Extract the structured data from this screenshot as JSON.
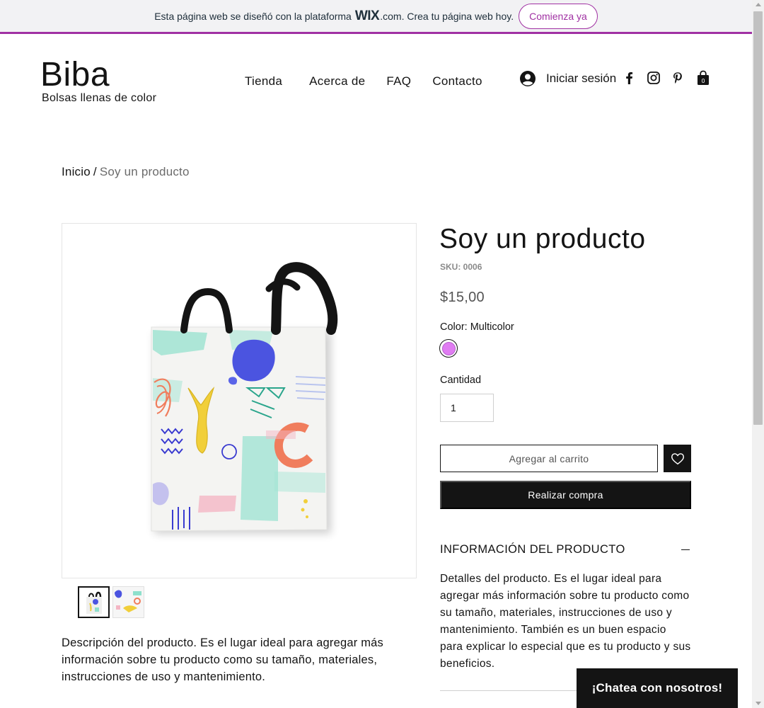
{
  "wix_banner": {
    "text_before": "Esta página web se diseñó con la plataforma",
    "logo_text": "WIX",
    "text_after": ".com. Crea tu página web hoy.",
    "cta": "Comienza ya",
    "accent_color": "#a031a3"
  },
  "header": {
    "brand": "Biba",
    "tagline": "Bolsas llenas de color",
    "nav": [
      "Tienda",
      "Acerca de",
      "FAQ",
      "Contacto"
    ],
    "login": "Iniciar sesión",
    "social_icons": [
      "facebook-icon",
      "instagram-icon",
      "pinterest-icon"
    ],
    "cart_count": "0"
  },
  "breadcrumb": {
    "home": "Inicio",
    "separator": "/",
    "current": "Soy un producto"
  },
  "product": {
    "title": "Soy un producto",
    "sku": "SKU: 0006",
    "price": "$15,00",
    "color_label": "Color: Multicolor",
    "swatch_color": "#e07cf2",
    "quantity_label": "Cantidad",
    "quantity": "1",
    "add_to_cart": "Agregar al carrito",
    "buy_now": "Realizar compra",
    "description": "Descripción del producto. Es el lugar ideal para agregar más información sobre tu producto como su tamaño, materiales, instrucciones de uso y mantenimiento.",
    "info_title": "INFORMACIÓN DEL PRODUCTO",
    "info_body": "Detalles del producto. Es el lugar ideal para agregar más información sobre tu producto como su tamaño, materiales, instrucciones de uso y mantenimiento. También es un buen espacio para explicar lo especial que es tu producto y sus beneficios."
  },
  "chat": {
    "label": "¡Chatea con nosotros!"
  }
}
